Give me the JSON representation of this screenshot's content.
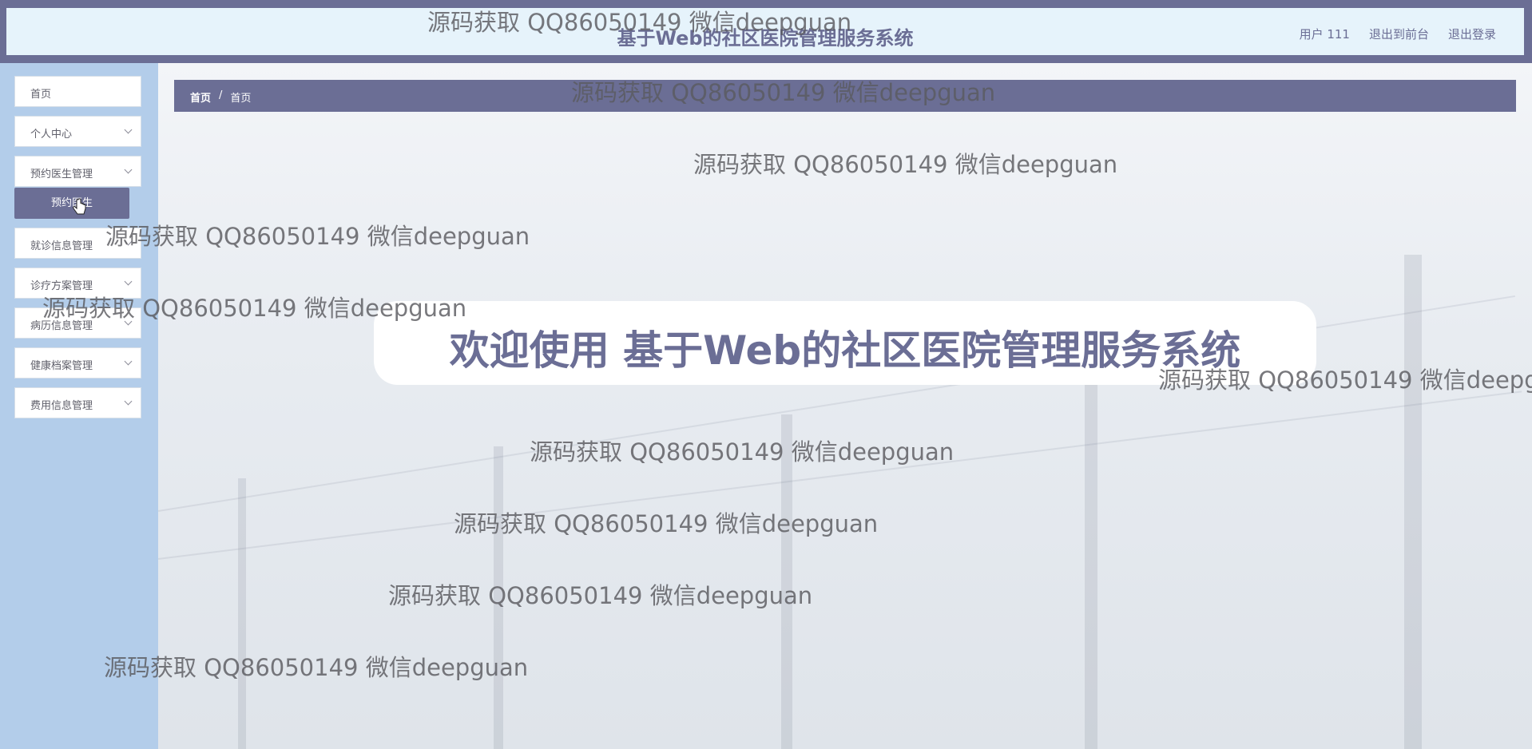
{
  "header": {
    "title": "基于Web的社区医院管理服务系统",
    "user_label": "用户 111",
    "to_front_label": "退出到前台",
    "logout_label": "退出登录"
  },
  "sidebar": {
    "items": [
      {
        "label": "首页"
      },
      {
        "label": "个人中心"
      },
      {
        "label": "预约医生管理"
      },
      {
        "label": "就诊信息管理"
      },
      {
        "label": "诊疗方案管理"
      },
      {
        "label": "病历信息管理"
      },
      {
        "label": "健康档案管理"
      },
      {
        "label": "费用信息管理"
      }
    ],
    "submenu": {
      "label": "预约医生"
    }
  },
  "breadcrumb": {
    "home": "首页",
    "separator": "/",
    "current": "首页"
  },
  "main": {
    "welcome": "欢迎使用 基于Web的社区医院管理服务系统"
  },
  "watermark": {
    "text": "源码获取 QQ86050149 微信deepguan"
  },
  "colors": {
    "accent": "#6b6e95",
    "header_bg": "#e6f3fb",
    "sidebar_bg": "#b3cdea"
  }
}
